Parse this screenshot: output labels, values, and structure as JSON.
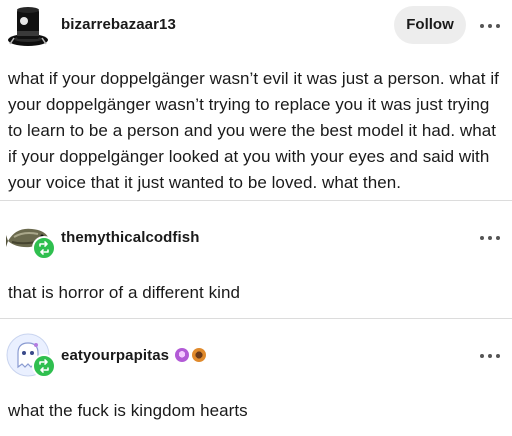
{
  "original_post": {
    "username": "bizarrebazaar13",
    "follow_label": "Follow",
    "text": "what if your doppelgänger wasn’t evil it was just a person. what if your doppelgänger wasn’t trying to replace you it was just trying to learn to be a person and you were the best model it had. what if your doppelgänger looked at you with your eyes and said with your voice that it just wanted to be loved. what then."
  },
  "reblogs": [
    {
      "username": "themythicalcodfish",
      "text": "that is horror of a different kind"
    },
    {
      "username": "eatyourpapitas",
      "text": "what the fuck is kingdom hearts"
    }
  ],
  "colors": {
    "reblog_badge": "#2fbf4f",
    "follow_bg": "#ededed",
    "divider": "#dcdcdc"
  }
}
